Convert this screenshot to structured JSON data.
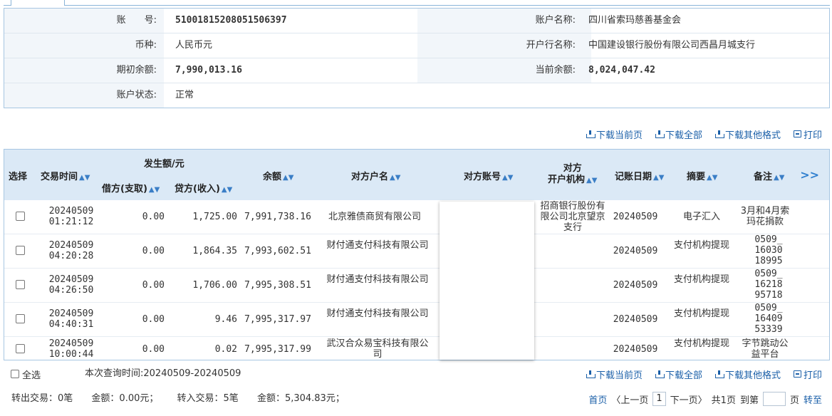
{
  "account": {
    "rows": [
      {
        "label_left": "账　　号:",
        "value_left": "51001815208051506397",
        "label_right": "账户名称:",
        "value_right": "四川省索玛慈善基金会"
      },
      {
        "label_left": "币种:",
        "value_left": "人民币元",
        "label_right": "开户行名称:",
        "value_right": "中国建设银行股份有限公司西昌月城支行"
      },
      {
        "label_left": "期初余额:",
        "value_left": "7,990,013.16",
        "label_right": "当前余额:",
        "value_right": "8,024,047.42"
      },
      {
        "label_left": "账户状态:",
        "value_left": "正常"
      }
    ]
  },
  "actions": {
    "download_current": "下载当前页",
    "download_all": "下载全部",
    "download_other": "下载其他格式",
    "print": "打印"
  },
  "table": {
    "headers": {
      "select": "选择",
      "time": "交易时间",
      "amount_group": "发生额/元",
      "debit": "借方(支取)",
      "credit": "贷方(收入)",
      "balance": "余额",
      "counterparty_name": "对方户名",
      "counterparty_account": "对方账号",
      "counterparty_org_line1": "对方",
      "counterparty_org_line2": "开户机构",
      "post_date": "记账日期",
      "summary": "摘要",
      "note": "备注",
      "more": ">>"
    },
    "rows": [
      {
        "date": "20240509",
        "time": "01:21:12",
        "debit": "0.00",
        "credit": "1,725.00",
        "balance": "7,991,738.16",
        "name": "北京雅债商贸有限公司",
        "org": "招商银行股份有限公司北京望京支行",
        "post_date": "20240509",
        "summary": "电子汇入",
        "note": "3月和4月索玛花捐款"
      },
      {
        "date": "20240509",
        "time": "04:20:28",
        "debit": "0.00",
        "credit": "1,864.35",
        "balance": "7,993,602.51",
        "name": "财付通支付科技有限公司",
        "org": "",
        "post_date": "20240509",
        "summary": "支付机构提现",
        "note": "0509_1603018995"
      },
      {
        "date": "20240509",
        "time": "04:26:50",
        "debit": "0.00",
        "credit": "1,706.00",
        "balance": "7,995,308.51",
        "name": "财付通支付科技有限公司",
        "org": "",
        "post_date": "20240509",
        "summary": "支付机构提现",
        "note": "0509_1621895718"
      },
      {
        "date": "20240509",
        "time": "04:40:31",
        "debit": "0.00",
        "credit": "9.46",
        "balance": "7,995,317.97",
        "name": "财付通支付科技有限公司",
        "org": "",
        "post_date": "20240509",
        "summary": "支付机构提现",
        "note": "0509_1640953339"
      },
      {
        "date": "20240509",
        "time": "10:00:44",
        "debit": "0.00",
        "credit": "0.02",
        "balance": "7,995,317.99",
        "name": "武汉合众易宝科技有限公司",
        "org": "",
        "post_date": "20240509",
        "summary": "支付机构提现",
        "note": "字节跳动公益平台"
      }
    ]
  },
  "footer": {
    "select_all": "全选",
    "query_time": "本次查询时间:20240509-20240509",
    "out_count": "转出交易：0笔",
    "out_amount": "金额：0.00元；",
    "in_count": "转入交易：5笔",
    "in_amount": "金额：5,304.83元；",
    "pager": {
      "first": "首页",
      "prev": "〈上一页",
      "current": "1",
      "next": "下一页〉",
      "total": "共1页",
      "goto_label": "到第",
      "page_unit": "页",
      "go": "转至"
    }
  }
}
